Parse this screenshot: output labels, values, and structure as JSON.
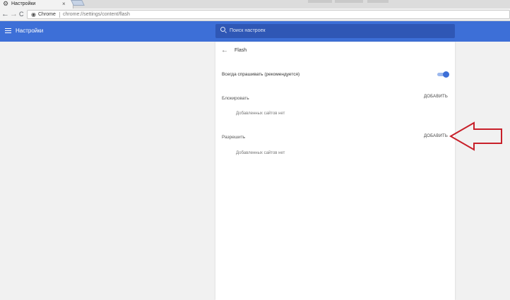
{
  "browser": {
    "tab_title": "Настройки",
    "tab_close": "×",
    "omnibox_label": "Chrome",
    "url": "chrome://settings/content/flash",
    "back_glyph": "←",
    "forward_glyph": "→",
    "reload_glyph": "C"
  },
  "header": {
    "title": "Настройки",
    "search_placeholder": "Поиск настроек"
  },
  "page": {
    "back_glyph": "←",
    "title": "Flash",
    "ask_first_label": "Всегда спрашивать (рекомендуется)",
    "ask_first_on": true,
    "block": {
      "label": "Блокировать",
      "add_label": "ДОБАВИТЬ",
      "empty_text": "Добавленных сайтов нет"
    },
    "allow": {
      "label": "Разрешить",
      "add_label": "ДОБАВИТЬ",
      "empty_text": "Добавленных сайтов нет"
    }
  },
  "colors": {
    "accent": "#3d6fd7",
    "annotation_arrow": "#c8202a"
  }
}
